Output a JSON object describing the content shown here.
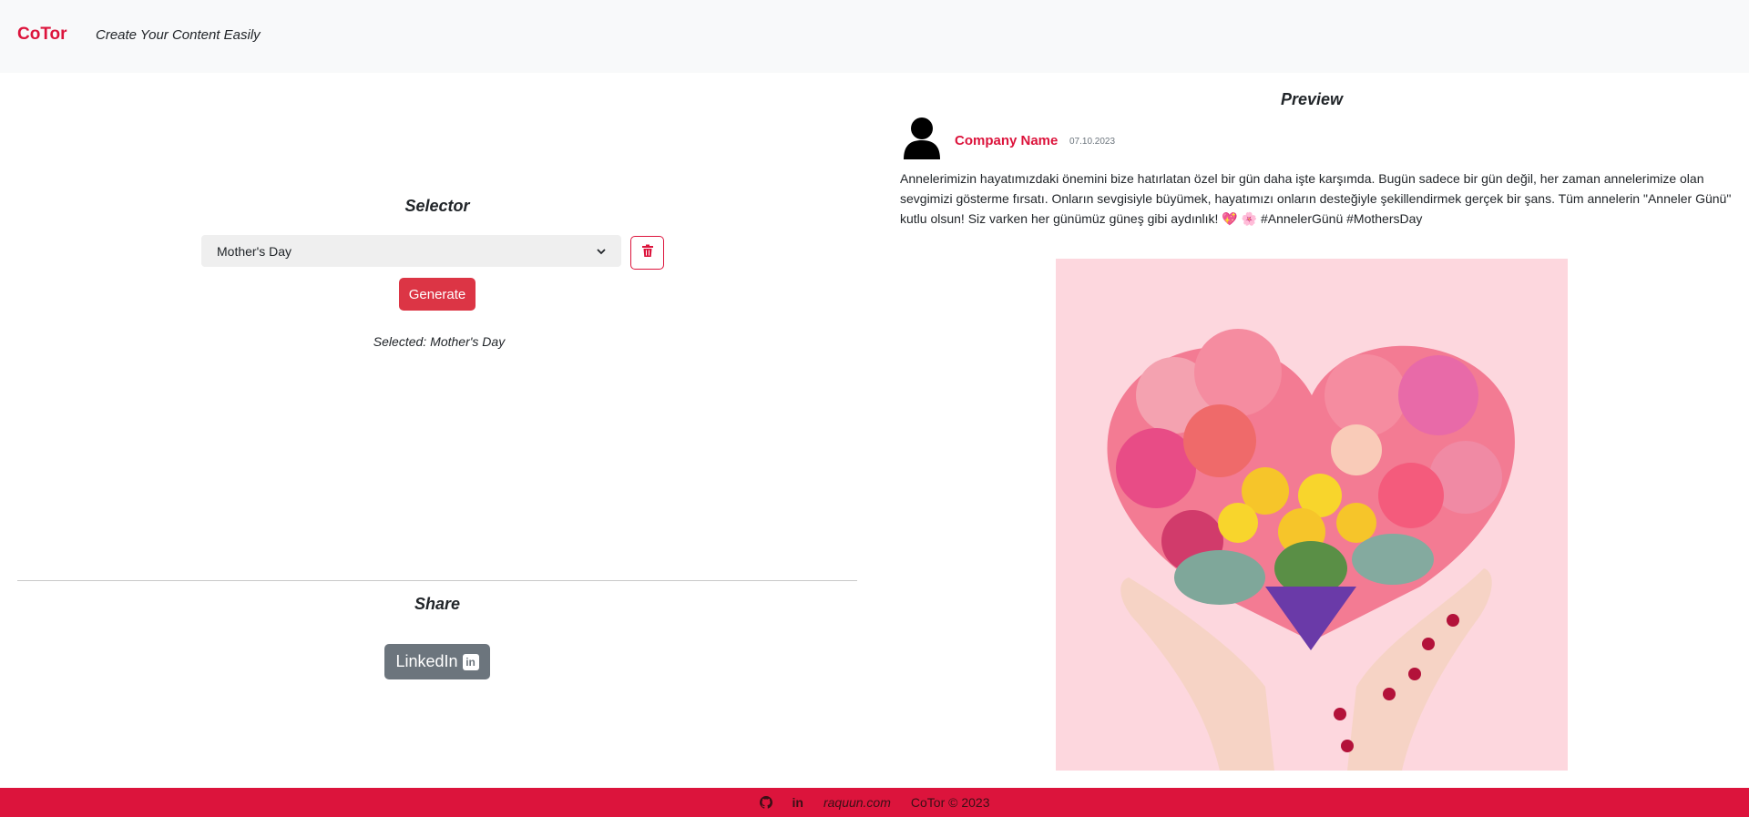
{
  "header": {
    "brand": "CoTor",
    "tagline": "Create Your Content Easily"
  },
  "selector": {
    "heading": "Selector",
    "selected_option": "Mother's Day",
    "generate_label": "Generate",
    "selected_prefix": "Selected:",
    "selected_value": "Mother's Day"
  },
  "share": {
    "heading": "Share",
    "linkedin_label": "LinkedIn",
    "linkedin_badge": "in"
  },
  "preview": {
    "heading": "Preview",
    "company_name": "Company Name",
    "date": "07.10.2023",
    "post_text": "Annelerimizin hayatımızdaki önemini bize hatırlatan özel bir gün daha işte karşımda. Bugün sadece bir gün değil, her zaman annelerimize olan sevgimizi gösterme fırsatı. Onların sevgisiyle büyümek, hayatımızı onların desteğiyle şekillendirmek gerçek bir şans. Tüm annelerin \"Anneler Günü\" kutlu olsun! Siz varken her günümüz güneş gibi aydınlık! 💖 🌸 #AnnelerGünü #MothersDay"
  },
  "footer": {
    "site": "raquun.com",
    "copyright": "CoTor © 2023",
    "linkedin_icon_text": "in"
  },
  "colors": {
    "accent": "#dc143c",
    "generate_button": "#dc3545",
    "linkedin_button": "#6c757d",
    "navbar_bg": "#f8f9fa",
    "image_bg": "#fdd7de"
  },
  "icons": {
    "trash": "trash-icon",
    "avatar": "user-avatar-icon",
    "github": "github-icon",
    "linkedin": "linkedin-icon",
    "chevron": "chevron-down-icon"
  }
}
